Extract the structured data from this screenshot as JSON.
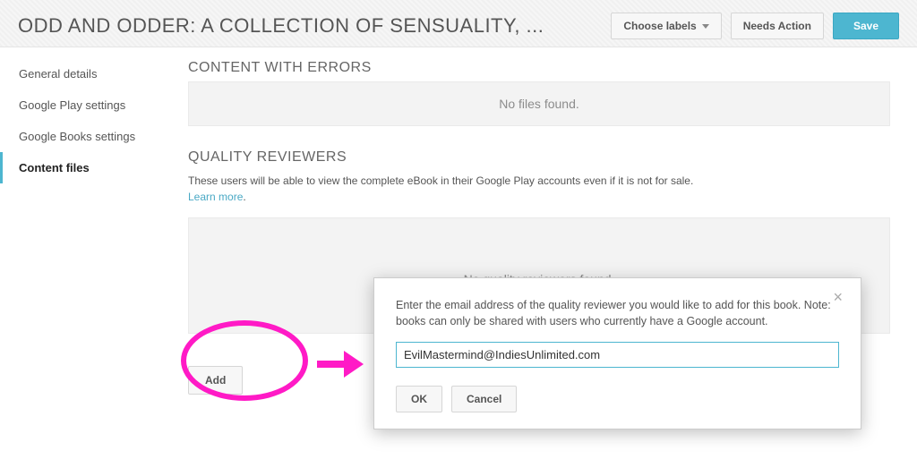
{
  "header": {
    "title": "ODD AND ODDER: A COLLECTION OF SENSUALITY, ...",
    "choose_labels": "Choose labels",
    "needs_action": "Needs Action",
    "save": "Save"
  },
  "sidebar": {
    "items": [
      {
        "label": "General details",
        "active": false
      },
      {
        "label": "Google Play settings",
        "active": false
      },
      {
        "label": "Google Books settings",
        "active": false
      },
      {
        "label": "Content files",
        "active": true
      }
    ]
  },
  "sections": {
    "errors_header": "CONTENT WITH ERRORS",
    "errors_empty": "No files found.",
    "reviewers_header": "QUALITY REVIEWERS",
    "reviewers_help_prefix": "These users will be able to view the complete eBook in their Google Play accounts even if it is not for sale. ",
    "reviewers_learn_more": "Learn more",
    "reviewers_empty": "No quality reviewers found.",
    "add_label": "Add"
  },
  "modal": {
    "text": "Enter the email address of the quality reviewer you would like to add for this book. Note: books can only be shared with users who currently have a Google account.",
    "input_value": "EvilMastermind@IndiesUnlimited.com",
    "ok": "OK",
    "cancel": "Cancel"
  }
}
